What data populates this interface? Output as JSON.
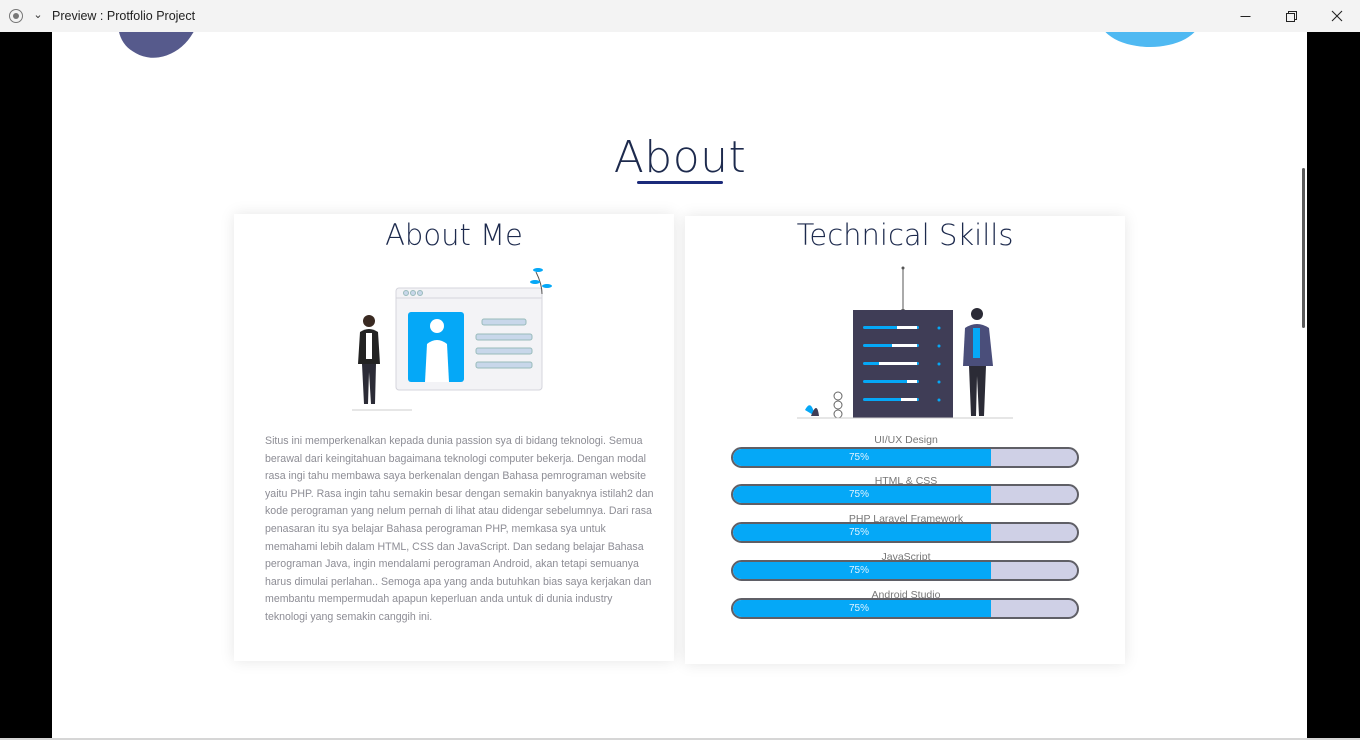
{
  "window": {
    "title": "Preview : Protfolio Project"
  },
  "section": {
    "title": "About"
  },
  "about_card": {
    "title": "About Me",
    "text": "Situs ini memperkenalkan kepada dunia passion sya di bidang teknologi. Semua berawal dari keingitahuan bagaimana teknologi computer bekerja. Dengan modal rasa ingi tahu membawa saya berkenalan dengan Bahasa pemrograman website yaitu PHP. Rasa ingin tahu semakin besar dengan semakin banyaknya istilah2 dan kode perograman yang nelum pernah di lihat atau didengar sebelumnya. Dari rasa penasaran itu sya belajar Bahasa perograman PHP, memkasa sya untuk memahami lebih dalam HTML, CSS dan JavaScript. Dan sedang belajar Bahasa perograman Java, ingin mendalami perograman Android, akan tetapi semuanya harus dimulai perlahan.. Semoga apa yang anda butuhkan bias saya kerjakan dan membantu mempermudah apapun keperluan anda untuk di dunia industry teknologi yang semakin canggih ini."
  },
  "skills_card": {
    "title": "Technical Skills",
    "skills": [
      {
        "label": "UI/UX Design",
        "percent_text": "75%",
        "value": 0.75
      },
      {
        "label": "HTML & CSS",
        "percent_text": "75%",
        "value": 0.75
      },
      {
        "label": "PHP Laravel Framework",
        "percent_text": "75%",
        "value": 0.75
      },
      {
        "label": "JavaScript",
        "percent_text": "75%",
        "value": 0.75
      },
      {
        "label": "Android Studio",
        "percent_text": "75%",
        "value": 0.75
      }
    ]
  },
  "colors": {
    "accent_blue": "#05a8f7",
    "title_navy": "#1d2a4d",
    "bar_track": "#cfd0e6"
  }
}
